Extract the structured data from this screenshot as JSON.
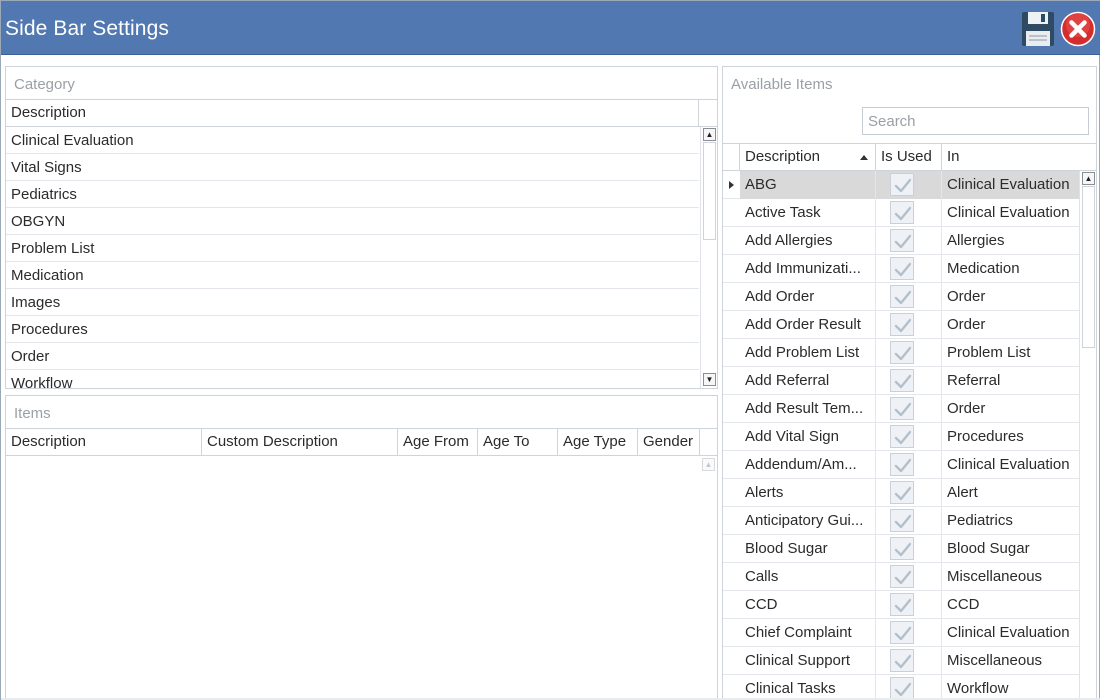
{
  "window": {
    "title": "Side Bar Settings",
    "accent_color": "#5178b0",
    "save_icon": "floppy-disk-icon",
    "close_icon": "close-circle-icon"
  },
  "category": {
    "caption": "Category",
    "column": "Description",
    "rows": [
      "Clinical Evaluation",
      "Vital Signs",
      "Pediatrics",
      "OBGYN",
      "Problem List",
      "Medication",
      "Images",
      "Procedures",
      "Order",
      "Workflow"
    ]
  },
  "items": {
    "caption": "Items",
    "columns": [
      "Description",
      "Custom Description",
      "Age From",
      "Age To",
      "Age Type",
      "Gender"
    ]
  },
  "available": {
    "caption": "Available Items",
    "search_placeholder": "Search",
    "columns": [
      "Description",
      "Is Used",
      "In"
    ],
    "selected_color": "#d9d9d9",
    "rows": [
      {
        "desc": "ABG",
        "used": true,
        "in": "Clinical Evaluation"
      },
      {
        "desc": "Active Task",
        "used": true,
        "in": "Clinical Evaluation"
      },
      {
        "desc": "Add Allergies",
        "used": true,
        "in": "Allergies"
      },
      {
        "desc": "Add Immunizati...",
        "used": true,
        "in": "Medication"
      },
      {
        "desc": "Add Order",
        "used": true,
        "in": "Order"
      },
      {
        "desc": "Add Order Result",
        "used": true,
        "in": "Order"
      },
      {
        "desc": "Add Problem List",
        "used": true,
        "in": "Problem List"
      },
      {
        "desc": "Add Referral",
        "used": true,
        "in": "Referral"
      },
      {
        "desc": "Add Result Tem...",
        "used": true,
        "in": "Order"
      },
      {
        "desc": "Add Vital Sign",
        "used": true,
        "in": "Procedures"
      },
      {
        "desc": "Addendum/Am...",
        "used": true,
        "in": "Clinical Evaluation"
      },
      {
        "desc": "Alerts",
        "used": true,
        "in": "Alert"
      },
      {
        "desc": "Anticipatory Gui...",
        "used": true,
        "in": "Pediatrics"
      },
      {
        "desc": "Blood Sugar",
        "used": true,
        "in": "Blood Sugar"
      },
      {
        "desc": "Calls",
        "used": true,
        "in": "Miscellaneous"
      },
      {
        "desc": "CCD",
        "used": true,
        "in": "CCD"
      },
      {
        "desc": "Chief Complaint",
        "used": true,
        "in": "Clinical Evaluation"
      },
      {
        "desc": "Clinical Support",
        "used": true,
        "in": "Miscellaneous"
      },
      {
        "desc": "Clinical Tasks",
        "used": true,
        "in": "Workflow"
      }
    ]
  }
}
